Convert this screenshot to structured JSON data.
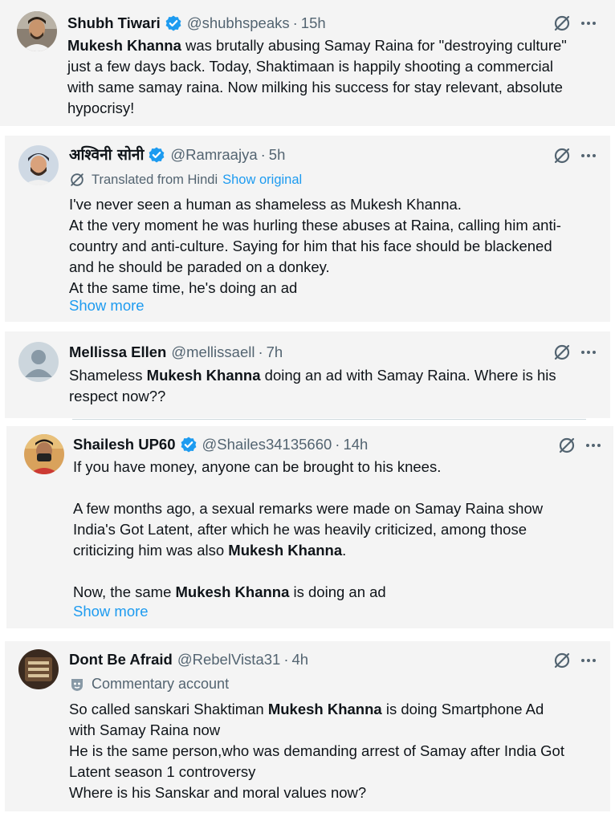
{
  "colors": {
    "accent": "#1d9bf0",
    "muted": "#536471",
    "text": "#0f1419",
    "card_bg": "#f4f4f4"
  },
  "posts": [
    {
      "name": "Shubh Tiwari",
      "handle": "@shubhspeaks",
      "sep": "·",
      "time": "15h",
      "body": [
        {
          "b": "Mukesh Khanna"
        },
        {
          "t": " was brutally abusing Samay Raina for \"destroying culture\"\njust a few days back. Today, Shaktimaan is happily shooting a commercial\nwith same samay raina. Now milking his success for stay relevant, absolute\nhypocrisy!"
        }
      ]
    },
    {
      "name": "अश्विनी सोनी",
      "handle": "@Ramraajya",
      "sep": "·",
      "time": "5h",
      "translated": "Translated from Hindi",
      "show_original": "Show original",
      "body": [
        {
          "t": "I've never seen a human as shameless as Mukesh Khanna.\nAt the very moment he was hurling these abuses at Raina, calling him anti-\ncountry and anti-culture. Saying for him that his face should be blackened\nand he should be paraded on a donkey.\nAt the same time, he's doing an ad"
        }
      ],
      "show_more": "Show more"
    },
    {
      "name": "Mellissa Ellen",
      "handle": "@mellissaell",
      "sep": "·",
      "time": "7h",
      "body": [
        {
          "t": "Shameless "
        },
        {
          "b": "Mukesh Khanna"
        },
        {
          "t": " doing an ad with Samay Raina. Where is his\nrespect now??"
        }
      ]
    },
    {
      "name": "Shailesh UP60",
      "handle": "@Shailes34135660",
      "sep": "·",
      "time": "14h",
      "body": [
        {
          "t": "If you have money, anyone can be brought to his knees.\n\nA few months ago, a sexual remarks were made on Samay Raina show\nIndia's Got Latent, after which he was heavily criticized, among those\ncriticizing him was also "
        },
        {
          "b": "Mukesh Khanna"
        },
        {
          "t": ".\n\nNow, the same "
        },
        {
          "b": "Mukesh Khanna"
        },
        {
          "t": " is doing an ad"
        }
      ],
      "show_more": "Show more"
    },
    {
      "name": "Dont Be Afraid",
      "handle": "@RebelVista31",
      "sep": "·",
      "time": "4h",
      "commentary": "Commentary account",
      "body": [
        {
          "t": "So called sanskari Shaktiman "
        },
        {
          "b": "Mukesh Khanna"
        },
        {
          "t": " is doing Smartphone Ad\nwith Samay Raina now\nHe is the same person,who was demanding arrest of Samay after India Got\nLatent season 1 controversy\nWhere is his Sanskar and moral values now?"
        }
      ]
    }
  ]
}
